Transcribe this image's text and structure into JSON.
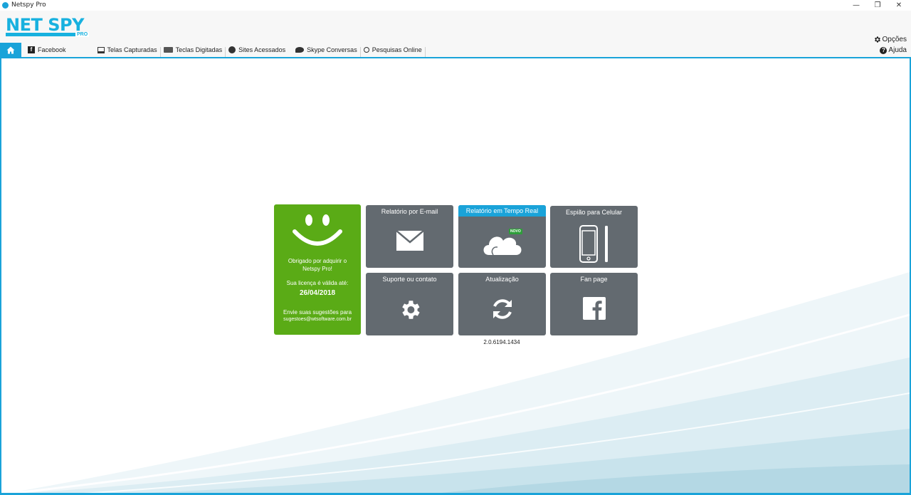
{
  "window": {
    "title": "Netspy Pro",
    "minimize": "—",
    "restore": "❐",
    "close": "✕"
  },
  "logo": {
    "text": "NET SPY",
    "sub": "PRO"
  },
  "header_links": {
    "options": "Opções",
    "help": "Ajuda"
  },
  "tabs": [
    {
      "label": "",
      "icon": "home-icon"
    },
    {
      "label": "Facebook",
      "icon": "facebook-icon"
    },
    {
      "label": "Telas Capturadas",
      "icon": "monitor-icon"
    },
    {
      "label": "Teclas Digitadas",
      "icon": "keyboard-icon"
    },
    {
      "label": "Sites Acessados",
      "icon": "globe-icon"
    },
    {
      "label": "Skype Conversas",
      "icon": "chat-icon"
    },
    {
      "label": "Pesquisas Online",
      "icon": "search-icon"
    }
  ],
  "welcome": {
    "thanks": "Obrigado por adquirir o Netspy Pro!",
    "license_label": "Sua licença é válida até:",
    "license_date": "26/04/2018",
    "suggest_label": "Envie suas sugestões para",
    "suggest_email": "sugestoes@wtsoftware.com.br"
  },
  "tiles": {
    "email_report": "Relatório por E-mail",
    "realtime_report": "Relatório em Tempo Real",
    "realtime_badge": "NOVO",
    "mobile_spy": "Espião para Celular",
    "support": "Suporte ou contato",
    "update": "Atualização",
    "fanpage": "Fan page"
  },
  "version": "2.0.6194.1434",
  "colors": {
    "accent": "#1aa3d9",
    "welcome_green": "#5aab16",
    "tile_gray": "#636a70",
    "badge_green": "#2e9e3a"
  }
}
